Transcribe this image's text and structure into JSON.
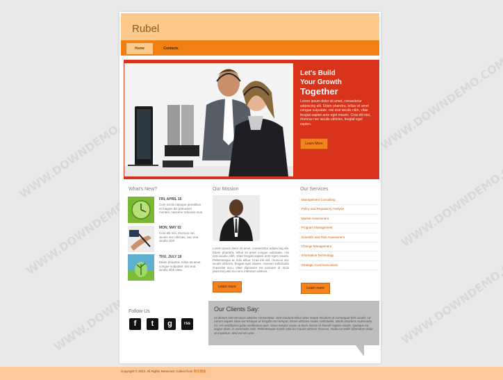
{
  "site": {
    "logo": "Rubel"
  },
  "nav": [
    {
      "label": "Home",
      "active": true
    },
    {
      "label": "Contacts",
      "active": false
    }
  ],
  "hero": {
    "title_line1": "Let's Build",
    "title_line2": "Your Growth",
    "title_line3": "Together",
    "text": "Lorem ipsum dolor sit amet, consectetur adipiscing elit. Etiam pharetra, tellus sit amet congue vulputate, nisi erat iaculis nibh, vitae feugiat sapien ante eget mauris. Cras elit nisl, rhoncus nec iaculis ultricies, feugiat eget sapien.",
    "button": "Learn More"
  },
  "news": {
    "title": "What's New?",
    "items": [
      {
        "date": "FRI, APRIL 15",
        "text": "Cum sociis natoque penatibus et magnis dis parturient montes, nascetur ridiculus mus."
      },
      {
        "date": "MON, MAY 02",
        "text": "Cras elit nisl, rhoncus nec iaculis nec ultricies, nec erat iaculis nibh."
      },
      {
        "date": "THU, JULY 18",
        "text": "Etiam pharetra, tellus sit amet congue vulputate, nisi erat iaculis nibh vitae."
      }
    ]
  },
  "mission": {
    "title": "Our Mission",
    "text": "Lorem ipsum dolor sit amet, consectetur adipiscing elit. Etiam pharetra, tellus sit amet congue vulputate, nisi erat iaculis nibh, vitae feugiat sapien ante eget mauris. Pellentesque ac felis tellus. Cras elit nisl, rhoncus nec iaculis ultricies, feugiat eget sapien. Aenean sollicitudin imperdiet arcu, vitae dignissim est posuere id. Duis placerat justo eu nunc interdum ultrices.",
    "button": "Learn more"
  },
  "services": {
    "title": "Our Services",
    "items": [
      "Management Consulting",
      "Policy and Regulatory Analysis",
      "Market Assessment",
      "Program Management",
      "Scientific and Risk Assessment",
      "Change Management",
      "Information Technology",
      "Strategic Communications"
    ],
    "button": "Learn more"
  },
  "follow": {
    "title": "Follow Us",
    "icons": [
      "f",
      "t",
      "g",
      "rss"
    ]
  },
  "clients": {
    "title": "Our Clients Say:",
    "text": "Ut dictum nisl vel lacus ultricies consectetur. Sed volutpat tellus vitae neque tincidunt ut consequat felis iaculis. Ut rutrum sapien vitae est tristique ut fringilla orci tempor. Etiam ultricies mattis sollicitudin. Morbi tincidunt malesuada mi, vel vestibulum justo vestibulum quis. Nunc tempor turpis ut diam lacinia id blandit sapien iaculis. Quisque eu augue diam, in venenatis ante. Pellentesque mattis odio eu mauris ultrices rhoncus. Nulla convallis bibendum dolor at maximus. Sed vel est ante."
  },
  "footer": {
    "text": "Copyright © 2012. All Rights Reserved. Collect from ",
    "link": "网页模板"
  },
  "watermark": "WWW.DOWNDEMO.COM",
  "colors": {
    "accent": "#f07f14",
    "hero": "#d8341c",
    "header": "#fdca8c"
  }
}
